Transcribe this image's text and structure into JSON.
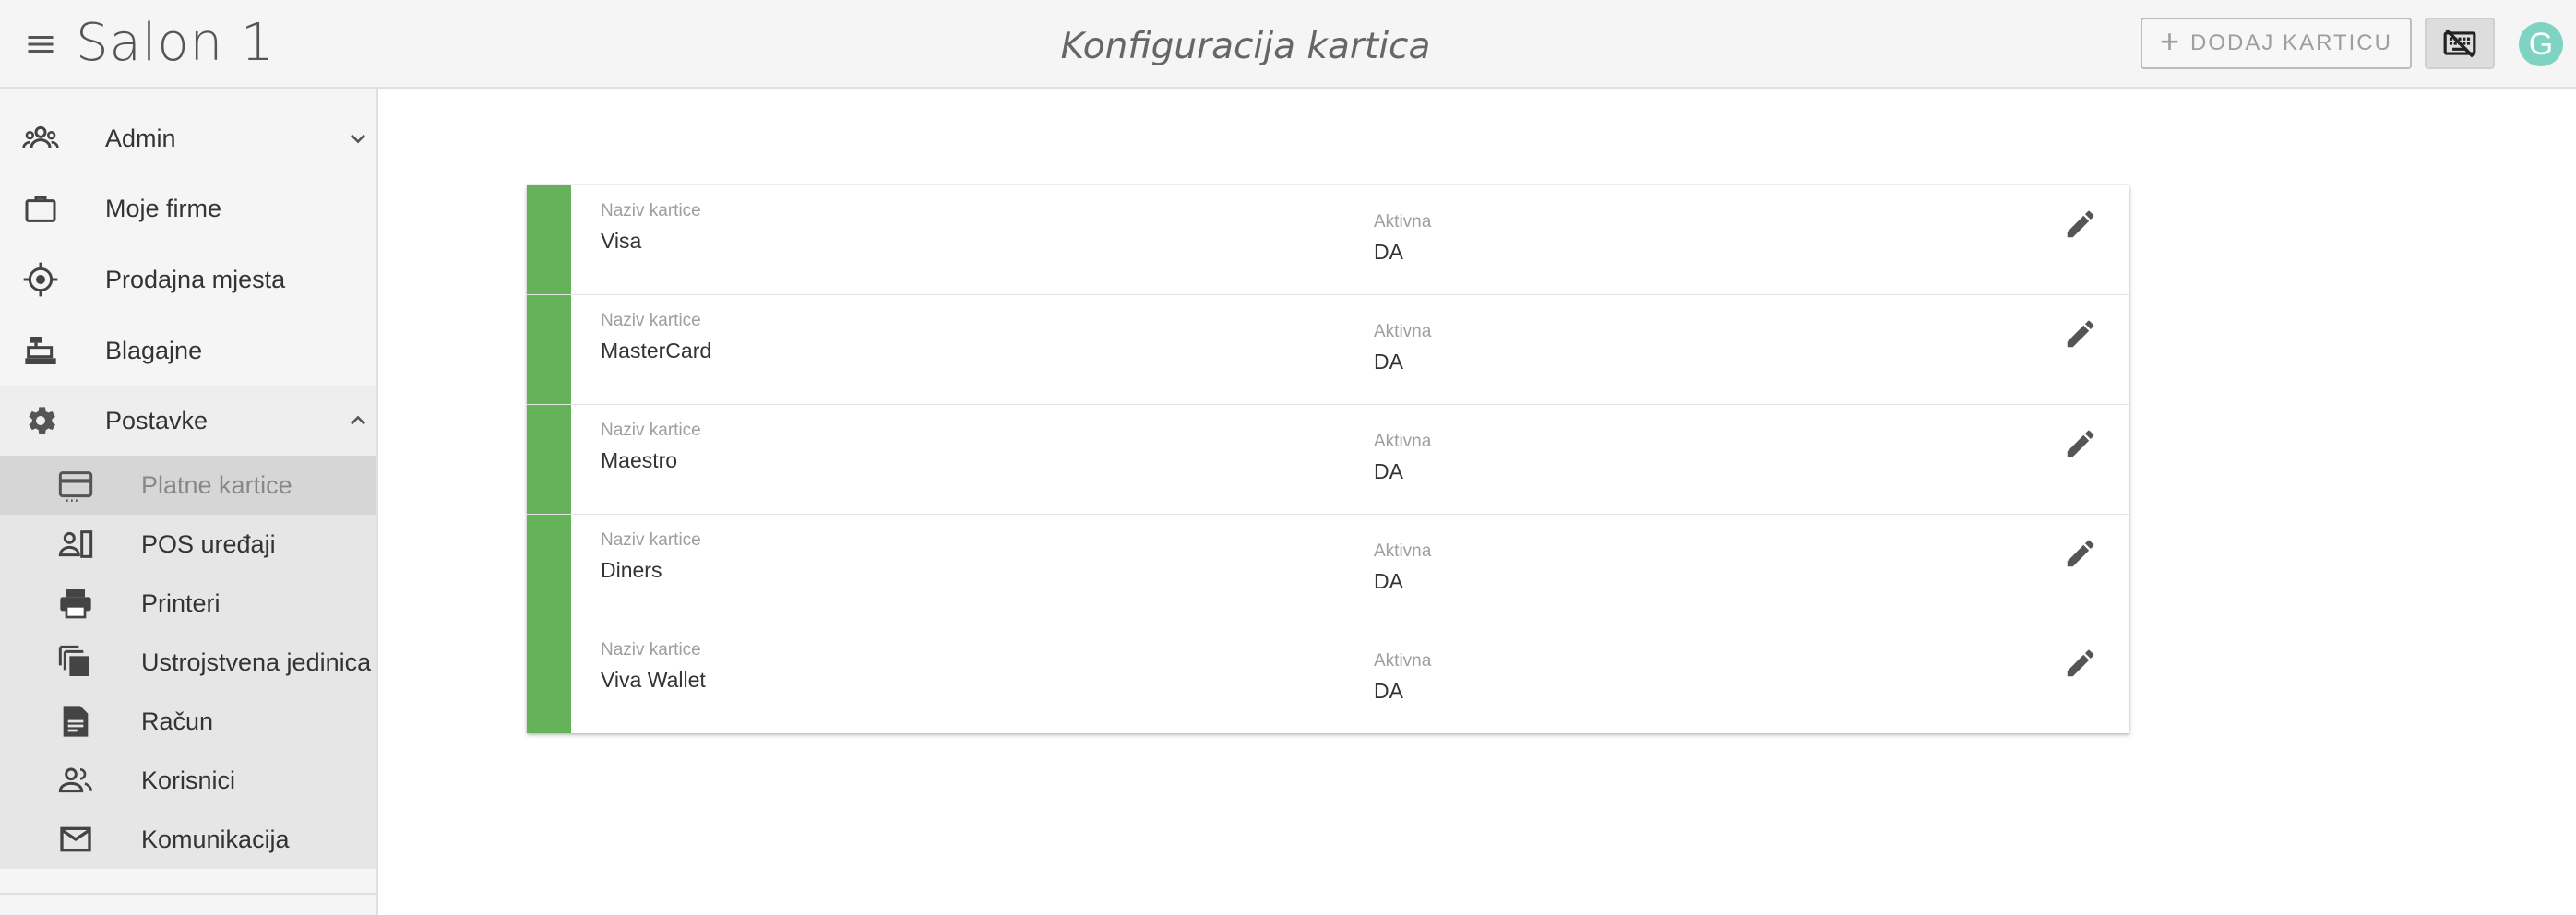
{
  "header": {
    "app_title": "Salon 1",
    "page_title": "Konfiguracija kartica",
    "add_button_label": "DODAJ KARTICU",
    "avatar_letter": "G"
  },
  "sidebar": {
    "items": [
      {
        "label": "Admin",
        "icon": "admin-group-icon"
      },
      {
        "label": "Moje firme",
        "icon": "briefcase-icon"
      },
      {
        "label": "Prodajna mjesta",
        "icon": "location-target-icon"
      },
      {
        "label": "Blagajne",
        "icon": "cash-register-icon"
      },
      {
        "label": "Postavke",
        "icon": "gear-icon"
      }
    ],
    "subitems": [
      {
        "label": "Platne kartice",
        "icon": "credit-card-icon",
        "selected": true
      },
      {
        "label": "POS uređaji",
        "icon": "pos-device-icon"
      },
      {
        "label": "Printeri",
        "icon": "printer-icon"
      },
      {
        "label": "Ustrojstvena jedinica",
        "icon": "library-stack-icon"
      },
      {
        "label": "Račun",
        "icon": "document-icon"
      },
      {
        "label": "Korisnici",
        "icon": "users-icon"
      },
      {
        "label": "Komunikacija",
        "icon": "mail-icon"
      }
    ]
  },
  "cards": {
    "name_label": "Naziv kartice",
    "active_label": "Aktivna",
    "accent_color": "#66b25a",
    "rows": [
      {
        "name": "Visa",
        "active": "DA"
      },
      {
        "name": "MasterCard",
        "active": "DA"
      },
      {
        "name": "Maestro",
        "active": "DA"
      },
      {
        "name": "Diners",
        "active": "DA"
      },
      {
        "name": "Viva Wallet",
        "active": "DA"
      }
    ]
  }
}
